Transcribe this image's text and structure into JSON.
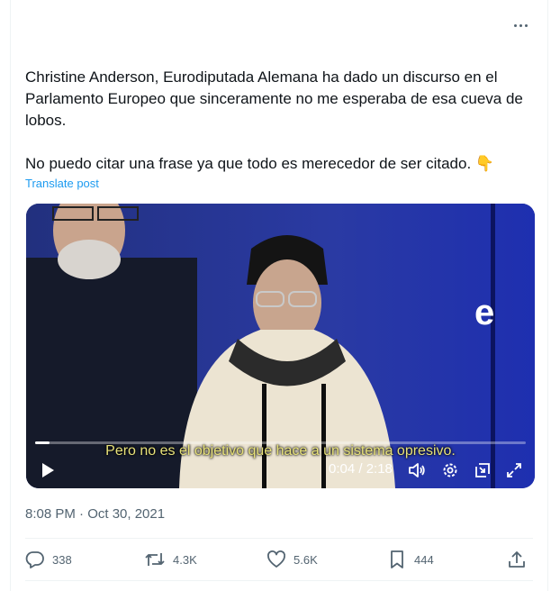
{
  "post": {
    "more_label": "More",
    "text": "Christine Anderson, Eurodiputada Alemana ha dado un discurso en el Parlamento Europeo que sinceramente no me esperaba de esa cueva de lobos.\n\nNo puedo citar una frase ya que todo es merecedor de ser citado. 👇",
    "translate_label": "Translate post",
    "timestamp": "8:08 PM · Oct 30, 2021"
  },
  "video": {
    "subtitle": "Pero no es el objetivo que hace a un sistema opresivo.",
    "time_display": "0:04 / 2:18",
    "progress": 0.029,
    "icons": [
      "play-icon",
      "volume-icon",
      "settings-icon",
      "picture-in-picture-icon",
      "fullscreen-icon"
    ]
  },
  "actions": {
    "replies": "338",
    "reposts": "4.3K",
    "likes": "5.6K",
    "bookmarks": "444"
  },
  "colors": {
    "accent": "#1d9bf0",
    "secondary_text": "#536471",
    "video_bg": "#1b2a7a"
  }
}
